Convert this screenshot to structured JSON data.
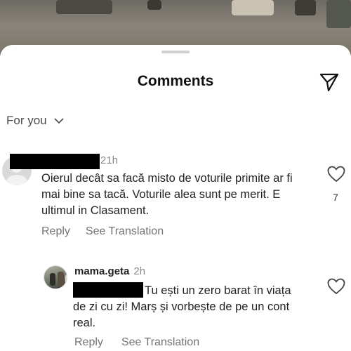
{
  "header": {
    "title": "Comments"
  },
  "sort": {
    "label": "For you"
  },
  "comments": [
    {
      "time": "21h",
      "text": "Oierul decât sa facă misto de voturile primite ar fi mai bine sa tacă. Voturile alea sunt pe merit. E ultimul in Clasament.",
      "like_count": "7",
      "reply_label": "Reply",
      "translate_label": "See Translation"
    }
  ],
  "replies": [
    {
      "username": "mama.geta",
      "time": "2h",
      "text": "Tu ești un zero barat în viața de zi cu zi! Marș și vorbește de pe un cont real.",
      "reply_label": "Reply",
      "translate_label": "See Translation"
    }
  ]
}
